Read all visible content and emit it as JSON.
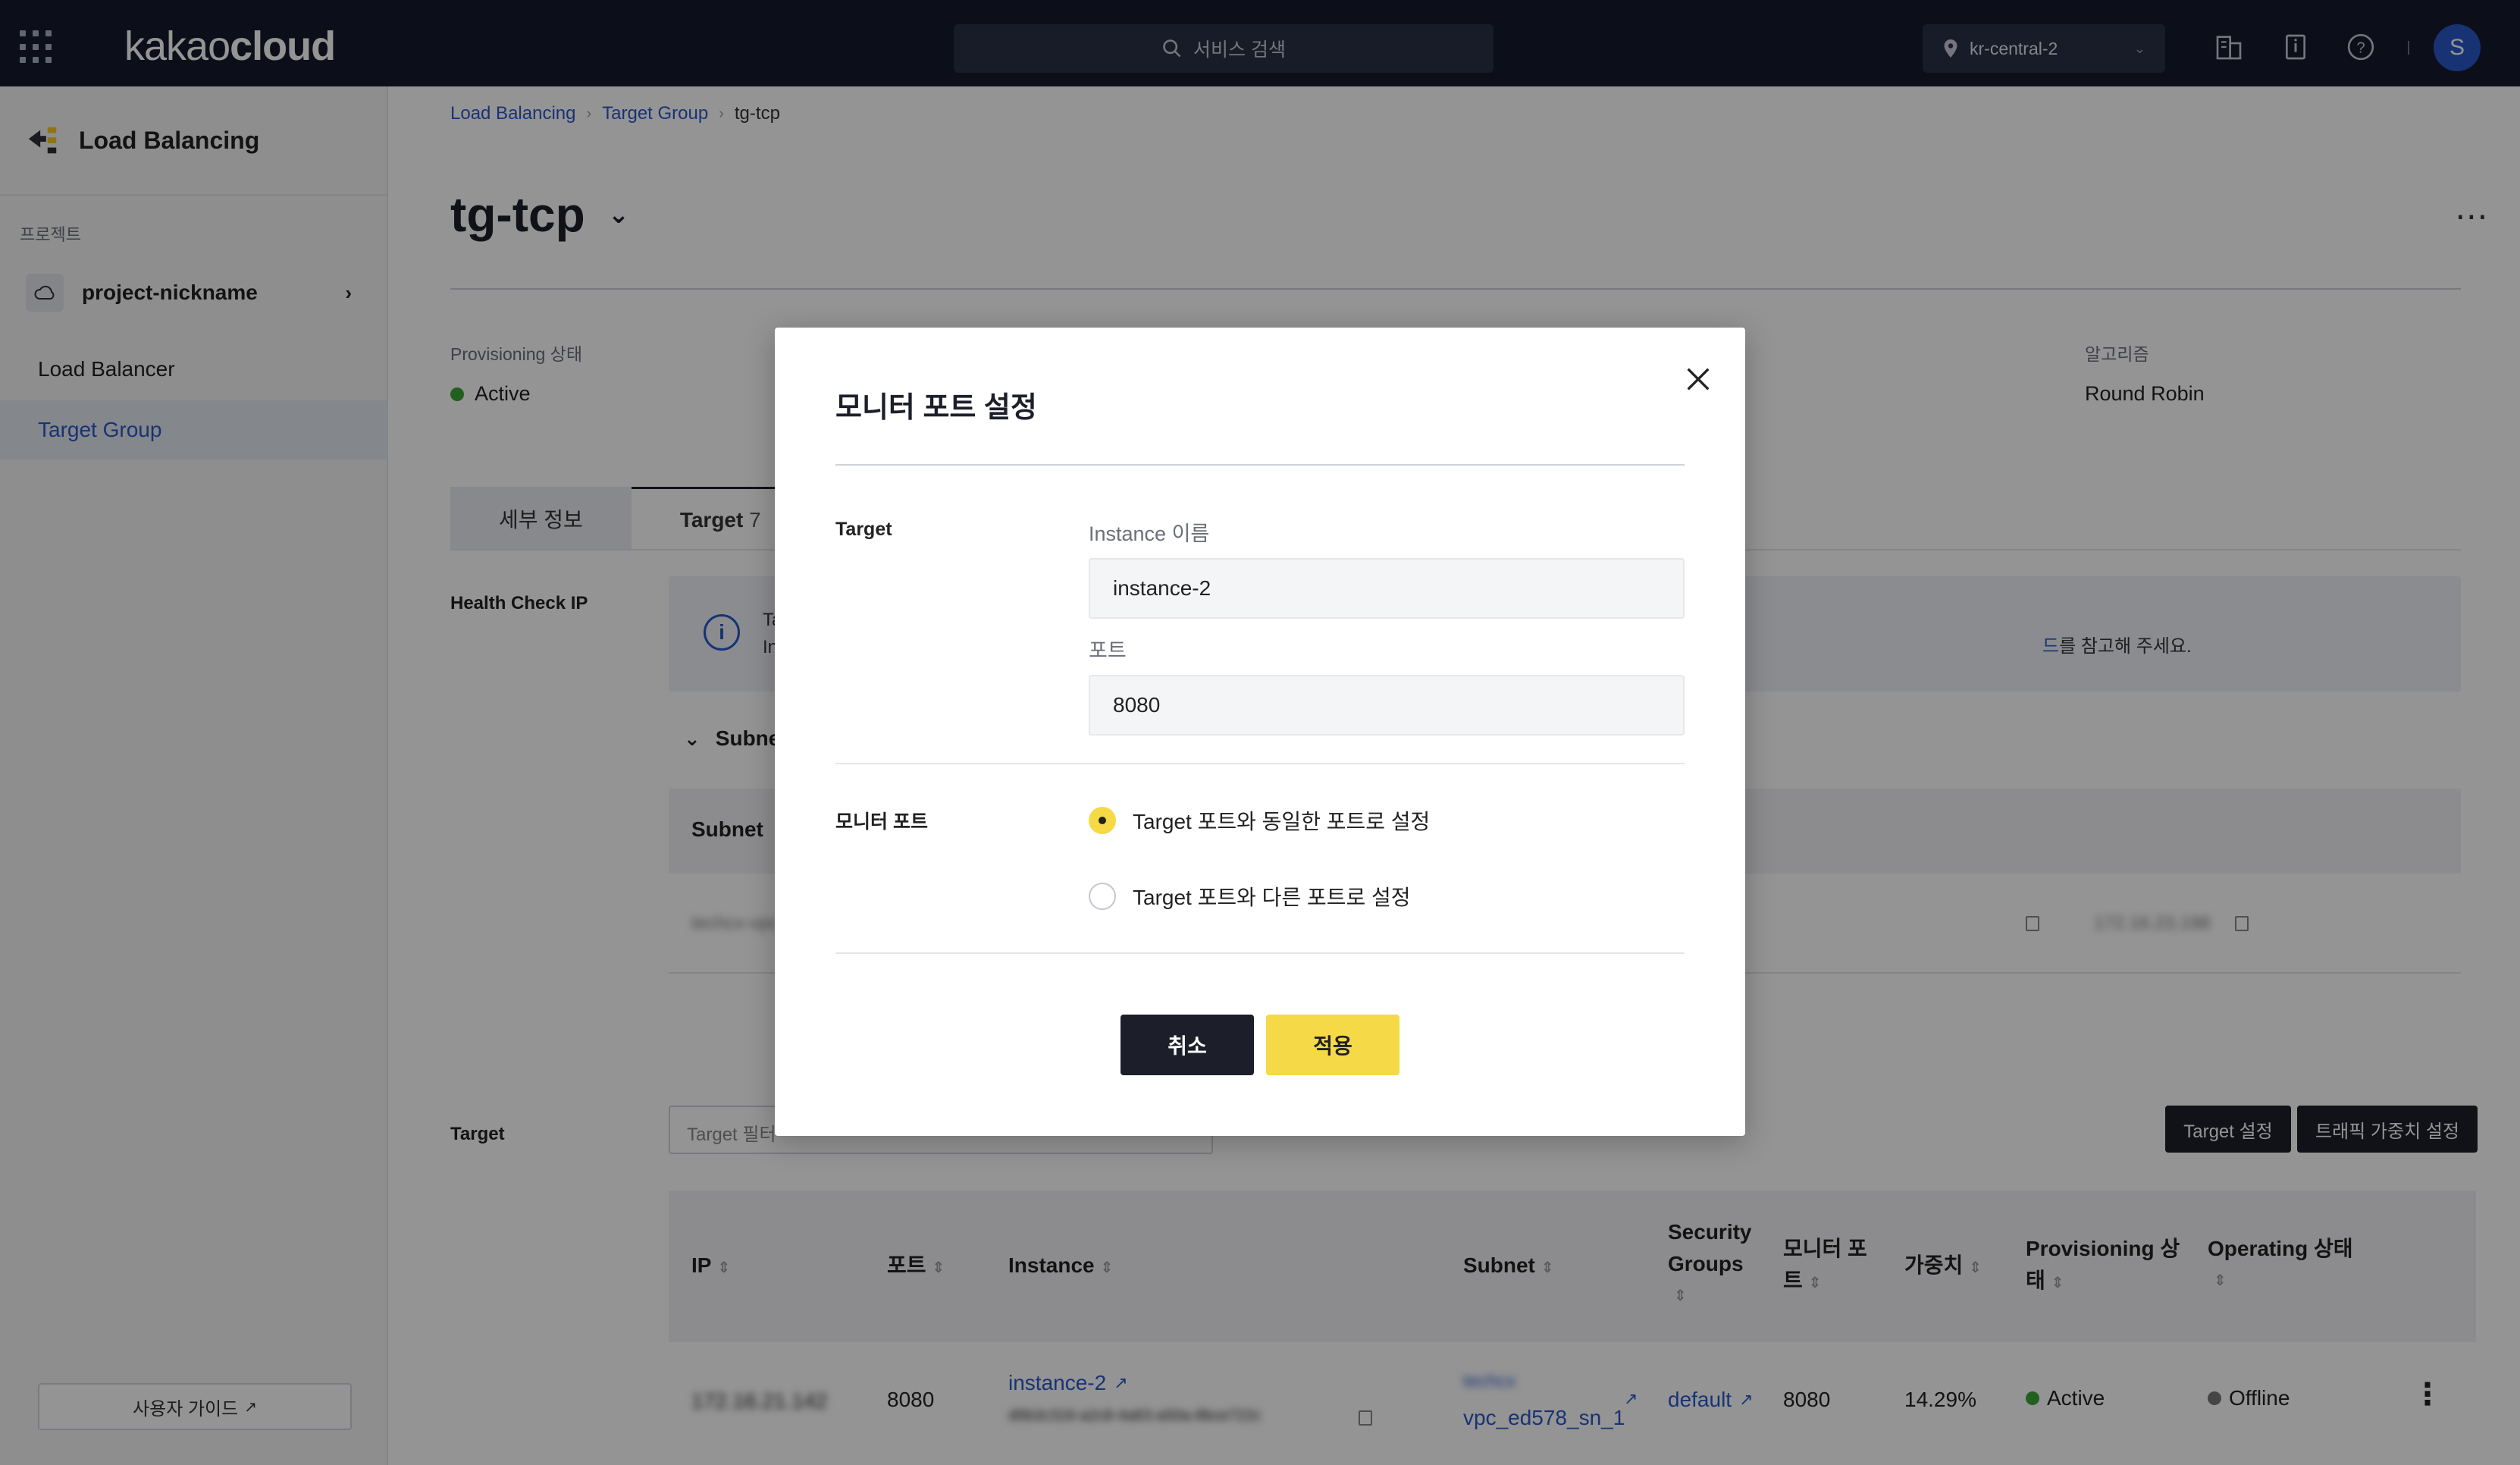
{
  "header": {
    "logo_light": "kakao",
    "logo_bold": "cloud",
    "search_placeholder": "서비스 검색",
    "region": "kr-central-2",
    "avatar": "S"
  },
  "sidebar": {
    "service_title": "Load Balancing",
    "project_label": "프로젝트",
    "project_name": "project-nickname",
    "items": [
      {
        "label": "Load Balancer"
      },
      {
        "label": "Target Group"
      }
    ],
    "guide_button": "사용자 가이드"
  },
  "breadcrumb": [
    "Load Balancing",
    "Target Group",
    "tg-tcp"
  ],
  "page": {
    "title": "tg-tcp",
    "provisioning_label": "Provisioning 상태",
    "provisioning_value": "Active",
    "algorithm_label": "알고리즘",
    "algorithm_value": "Round Robin"
  },
  "tabs": [
    {
      "label": "세부 정보"
    },
    {
      "label": "Target",
      "count": "7"
    }
  ],
  "health_check": {
    "label": "Health Check IP",
    "info_tail_link": "드",
    "info_tail": "를 참고해 주세요.",
    "info_line1_start": "Ta",
    "info_line2_start": "In",
    "subnet_toggle": "Subne",
    "subnet_header": "Subnet",
    "row_blur1": "techcx-vpc",
    "row_blur2": "172.16.23.198"
  },
  "target_section": {
    "label": "Target",
    "filter_placeholder": "Target 필터",
    "btn_target_setting": "Target 설정",
    "btn_weight_setting": "트래픽 가중치 설정",
    "columns": {
      "ip": "IP",
      "port": "포트",
      "instance": "Instance",
      "subnet": "Subnet",
      "security_groups_1": "Security",
      "security_groups_2": "Groups",
      "monitor_port_1": "모니터 포",
      "monitor_port_2": "트",
      "weight": "가중치",
      "provisioning_1": "Provisioning 상",
      "provisioning_2": "태",
      "operating": "Operating 상태"
    },
    "rows": [
      {
        "ip": "172.16.21.142",
        "port": "8080",
        "instance": "instance-2",
        "instance_id": "d0b3c316-a2c8-4a63-a50a-8bce722c",
        "subnet_top": "techcx",
        "subnet": "vpc_ed578_sn_1",
        "security_group": "default",
        "monitor_port": "8080",
        "weight": "14.29%",
        "provisioning": "Active",
        "operating": "Offline"
      }
    ]
  },
  "modal": {
    "title": "모니터 포트 설정",
    "target_label": "Target",
    "instance_label": "Instance 이름",
    "instance_value": "instance-2",
    "port_label": "포트",
    "port_value": "8080",
    "monitor_port_label": "모니터 포트",
    "option_same": "Target 포트와 동일한 포트로 설정",
    "option_diff": "Target 포트와 다른 포트로 설정",
    "selected_option": "same",
    "cancel": "취소",
    "apply": "적용"
  },
  "colors": {
    "topbar": "#15192e",
    "accent_yellow": "#f6d946",
    "link_blue": "#2a58c8",
    "status_active": "#3aa635",
    "status_offline": "#777777"
  }
}
